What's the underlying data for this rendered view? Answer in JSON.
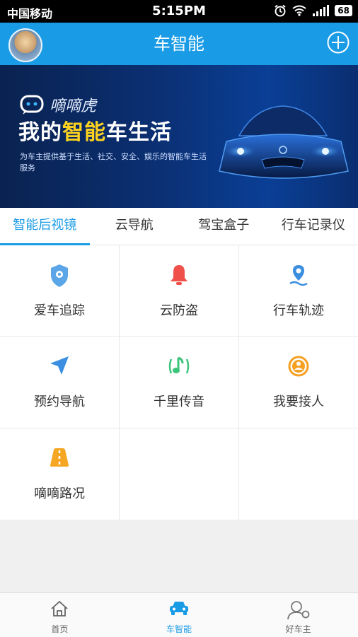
{
  "status_bar": {
    "carrier": "中国移动",
    "time": "5:15PM",
    "battery": "68"
  },
  "header": {
    "title": "车智能"
  },
  "banner": {
    "brand": "嘀嘀虎",
    "slogan_pre": "我的",
    "slogan_highlight": "智能",
    "slogan_post": "车生活",
    "description": "为车主提供基于生活、社交、安全、娱乐的智能车生活服务"
  },
  "tabs": [
    {
      "label": "智能后视镜",
      "active": true
    },
    {
      "label": "云导航",
      "active": false
    },
    {
      "label": "驾宝盒子",
      "active": false
    },
    {
      "label": "行车记录仪",
      "active": false
    }
  ],
  "features": [
    {
      "label": "爱车追踪",
      "icon": "shield-location-icon",
      "color": "#5aa6e8"
    },
    {
      "label": "云防盗",
      "icon": "bell-icon",
      "color": "#f0504a"
    },
    {
      "label": "行车轨迹",
      "icon": "track-pin-icon",
      "color": "#3c8fe0"
    },
    {
      "label": "预约导航",
      "icon": "navigation-arrow-icon",
      "color": "#3c8fe0"
    },
    {
      "label": "千里传音",
      "icon": "music-note-icon",
      "color": "#3cc47a"
    },
    {
      "label": "我要接人",
      "icon": "person-target-icon",
      "color": "#f5a020"
    },
    {
      "label": "嘀嘀路况",
      "icon": "road-icon",
      "color": "#f5a623"
    }
  ],
  "bottom_nav": [
    {
      "label": "首页",
      "icon": "home-icon",
      "active": false
    },
    {
      "label": "车智能",
      "icon": "car-icon",
      "active": true
    },
    {
      "label": "好车主",
      "icon": "user-icon",
      "active": false
    }
  ],
  "colors": {
    "primary": "#1a9be6",
    "banner_dark": "#0a2250",
    "highlight": "#ffd21f"
  }
}
